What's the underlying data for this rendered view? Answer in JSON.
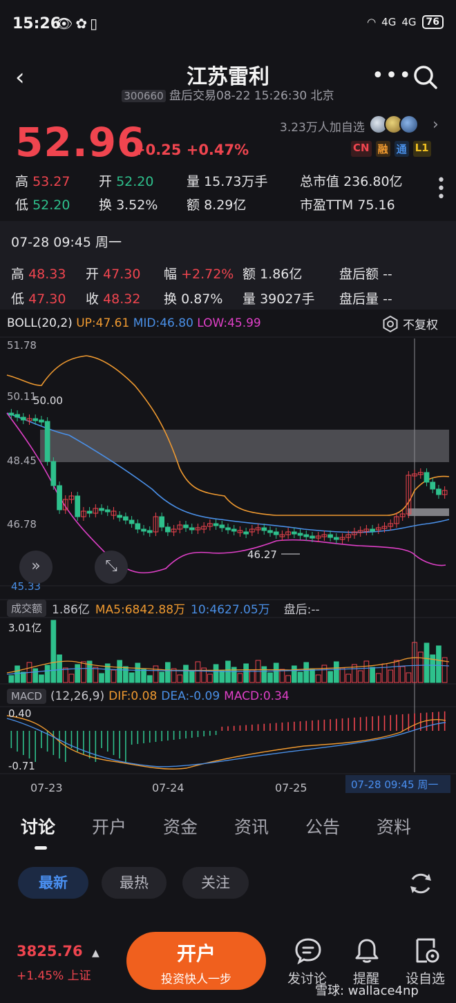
{
  "status": {
    "time": "15:26",
    "battery": "76",
    "net1": "4G",
    "net2": "4G"
  },
  "header": {
    "title": "江苏雷利",
    "code": "300660",
    "subtitle": "盘后交易08-22 15:26:30 北京"
  },
  "quote": {
    "price": "52.96",
    "change": "+0.25 +0.47%",
    "watchers": "3.23万人加自选",
    "badges": [
      {
        "label": "CN",
        "color": "#f0454f",
        "bg": "#3a1c1e"
      },
      {
        "label": "融",
        "color": "#f09a30",
        "bg": "#3a2a16"
      },
      {
        "label": "通",
        "color": "#4a90e8",
        "bg": "#18283e"
      },
      {
        "label": "L1",
        "color": "#f0c020",
        "bg": "#3a3214"
      }
    ],
    "high_label": "高",
    "high": "53.27",
    "open_label": "开",
    "open": "52.20",
    "volume_label": "量",
    "volume": "15.73万手",
    "mktcap_label": "总市值",
    "mktcap": "236.80亿",
    "low_label": "低",
    "low": "52.20",
    "turnover_label": "换",
    "turnover": "3.52%",
    "amount_label": "额",
    "amount": "8.29亿",
    "pe_label": "市盈TTM",
    "pe": "75.16"
  },
  "detail": {
    "datetime": "07-28 09:45 周一",
    "high_label": "高",
    "high": "48.33",
    "open_label": "开",
    "open": "47.30",
    "amp_label": "幅",
    "amp": "+2.72%",
    "amount_label": "额",
    "amount": "1.86亿",
    "ah_amount_label": "盘后额",
    "ah_amount": "--",
    "low_label": "低",
    "low": "47.30",
    "close_label": "收",
    "close": "48.32",
    "turnover_label": "换",
    "turnover": "0.87%",
    "vol_label": "量",
    "vol": "39027手",
    "ah_vol_label": "盘后量",
    "ah_vol": "--"
  },
  "boll": {
    "label": "BOLL(20,2)",
    "up": "UP:47.61",
    "mid": "MID:46.80",
    "low": "LOW:45.99",
    "adj": "不复权",
    "y_ticks": [
      "51.78",
      "50.11",
      "48.45",
      "46.78",
      "45.33"
    ],
    "max_note": "50.00",
    "min_note": "46.27"
  },
  "volume": {
    "tag": "成交额",
    "value": "1.86亿",
    "ma5": "MA5:6842.88万",
    "ma10": "10:4627.05万",
    "after": "盘后:--",
    "max": "3.01亿"
  },
  "macd": {
    "tag": "MACD",
    "params": "(12,26,9)",
    "dif": "DIF:0.08",
    "dea": "DEA:-0.09",
    "macd": "MACD:0.34",
    "max": "0.40",
    "min": "-0.71"
  },
  "x_axis": {
    "labels": [
      "07-23",
      "07-24",
      "07-25"
    ],
    "cursor": "07-28 09:45 周一"
  },
  "tabs": [
    "讨论",
    "开户",
    "资金",
    "资讯",
    "公告",
    "资料"
  ],
  "filters": [
    "最新",
    "最热",
    "关注"
  ],
  "bottom": {
    "index_value": "3825.76",
    "index_change": "+1.45% 上证",
    "open_main": "开户",
    "open_sub": "投资快人一步",
    "post": "发讨论",
    "remind": "提醒",
    "watchlist": "设自选",
    "watermark": "雪球: wallace4np"
  },
  "colors": {
    "up": "#f0454f",
    "down": "#2ec08c",
    "accent": "#f0601e",
    "boll_up": "#f09a30",
    "boll_mid": "#4a90e8",
    "boll_low": "#e040c8"
  }
}
